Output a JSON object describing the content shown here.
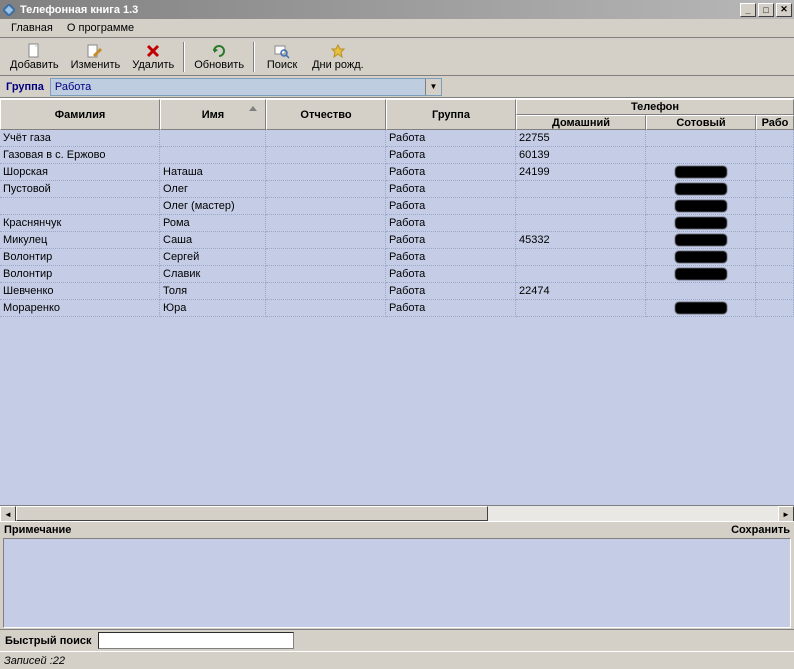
{
  "window": {
    "title": "Телефонная книга 1.3"
  },
  "menu": {
    "main": "Главная",
    "about": "О программе"
  },
  "toolbar": {
    "add": "Добавить",
    "edit": "Изменить",
    "delete": "Удалить",
    "refresh": "Обновить",
    "search": "Поиск",
    "birthday": "Дни рожд."
  },
  "filter": {
    "label": "Группа",
    "value": "Работа"
  },
  "columns": {
    "surname": "Фамилия",
    "name": "Имя",
    "patronym": "Отчество",
    "group": "Группа",
    "phone_group": "Телефон",
    "home": "Домашний",
    "mobile": "Сотовый",
    "work": "Рабо"
  },
  "rows": [
    {
      "surname": "Учёт газа",
      "name": "",
      "patronym": "",
      "group": "Работа",
      "home": "22755",
      "mobile": ""
    },
    {
      "surname": "Газовая в с. Ержово",
      "name": "",
      "patronym": "",
      "group": "Работа",
      "home": "60139",
      "mobile": ""
    },
    {
      "surname": "Шорская",
      "name": "Наташа",
      "patronym": "",
      "group": "Работа",
      "home": "24199",
      "mobile": "[redacted]"
    },
    {
      "surname": "Пустовой",
      "name": "Олег",
      "patronym": "",
      "group": "Работа",
      "home": "",
      "mobile": "[redacted]"
    },
    {
      "surname": "",
      "name": "Олег (мастер)",
      "patronym": "",
      "group": "Работа",
      "home": "",
      "mobile": "[redacted]"
    },
    {
      "surname": "Краснянчук",
      "name": "Рома",
      "patronym": "",
      "group": "Работа",
      "home": "",
      "mobile": "[redacted]"
    },
    {
      "surname": "Микулец",
      "name": "Саша",
      "patronym": "",
      "group": "Работа",
      "home": "45332",
      "mobile": "[redacted]"
    },
    {
      "surname": "Волонтир",
      "name": "Сергей",
      "patronym": "",
      "group": "Работа",
      "home": "",
      "mobile": "[redacted]"
    },
    {
      "surname": "Волонтир",
      "name": "Славик",
      "patronym": "",
      "group": "Работа",
      "home": "",
      "mobile": "[redacted]"
    },
    {
      "surname": "Шевченко",
      "name": "Толя",
      "patronym": "",
      "group": "Работа",
      "home": "22474",
      "mobile": ""
    },
    {
      "surname": "Мораренко",
      "name": "Юра",
      "patronym": "",
      "group": "Работа",
      "home": "",
      "mobile": "[redacted]"
    }
  ],
  "note": {
    "label": "Примечание",
    "save": "Сохранить"
  },
  "quicksearch": {
    "label": "Быстрый поиск",
    "value": ""
  },
  "status": {
    "records": "Записей :22"
  }
}
